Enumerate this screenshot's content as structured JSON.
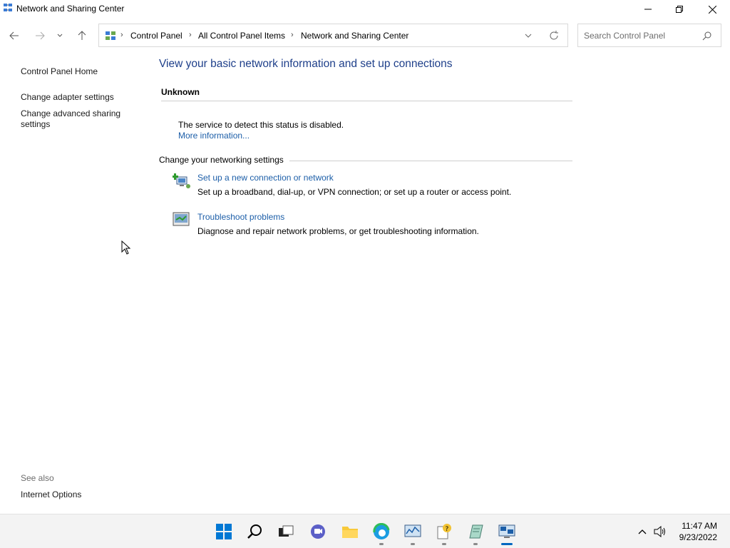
{
  "window": {
    "title": "Network and Sharing Center",
    "minimize_icon": "minimize-icon",
    "maximize_icon": "restore-icon",
    "close_icon": "close-icon"
  },
  "navigation": {
    "breadcrumbs": [
      "Control Panel",
      "All Control Panel Items",
      "Network and Sharing Center"
    ],
    "search_placeholder": "Search Control Panel"
  },
  "sidebar": {
    "home": "Control Panel Home",
    "items": [
      "Change adapter settings",
      "Change advanced sharing",
      "settings"
    ],
    "see_also_label": "See also",
    "see_also_items": [
      "Internet Options"
    ]
  },
  "main": {
    "title": "View your basic network information and set up connections",
    "network_name": "Unknown",
    "status_text": "The service to detect this status is disabled.",
    "more_info": "More information...",
    "section_label": "Change your networking settings",
    "tasks": [
      {
        "link": "Set up a new connection or network",
        "desc": "Set up a broadband, dial-up, or VPN connection; or set up a router or access point.",
        "icon": "new-connection-icon"
      },
      {
        "link": "Troubleshoot problems",
        "desc": "Diagnose and repair network problems, or get troubleshooting information.",
        "icon": "troubleshoot-icon"
      }
    ]
  },
  "taskbar": {
    "time": "11:47 AM",
    "date": "9/23/2022",
    "accent": "#0067c0"
  }
}
